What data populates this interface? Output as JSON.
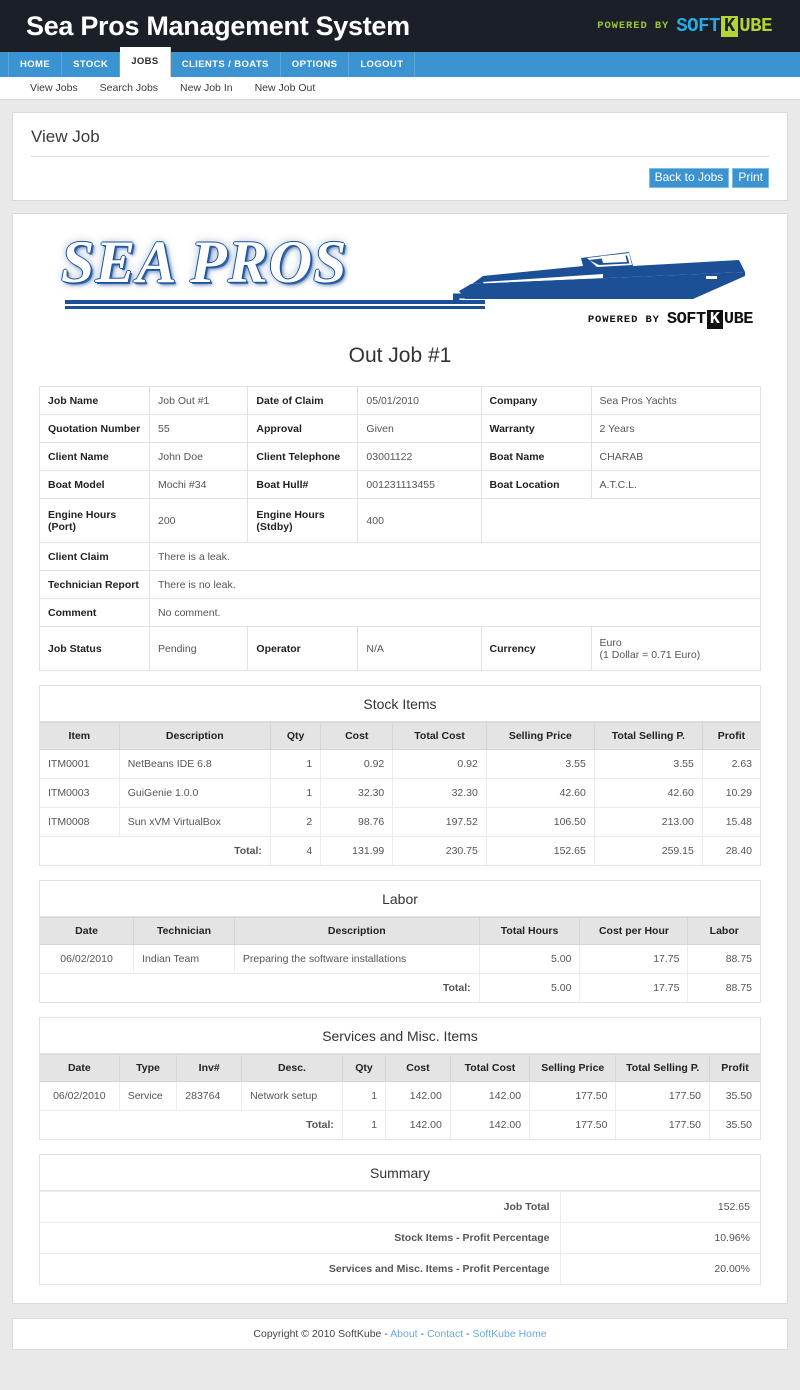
{
  "header": {
    "app_title": "Sea Pros Management System",
    "brand": {
      "powered_by": "POWERED BY",
      "soft": "SOFT",
      "k": "K",
      "ube": "UBE"
    },
    "brand_colors": {
      "powered_by": "#9ec43a",
      "soft": "#29abe2",
      "ube": "#b5d334",
      "k_bg": "#b5d334",
      "bar_bg": "#1b1f27"
    }
  },
  "nav": {
    "tabs": [
      {
        "label": "HOME",
        "active": false
      },
      {
        "label": "STOCK",
        "active": false
      },
      {
        "label": "JOBS",
        "active": true
      },
      {
        "label": "CLIENTS / BOATS",
        "active": false
      },
      {
        "label": "OPTIONS",
        "active": false
      },
      {
        "label": "LOGOUT",
        "active": false
      }
    ],
    "accent": "#3b93d1",
    "subnav": [
      "View Jobs",
      "Search Jobs",
      "New Job In",
      "New Job Out"
    ]
  },
  "page": {
    "title": "View Job",
    "buttons": [
      {
        "label": "Back to Jobs"
      },
      {
        "label": "Print"
      }
    ]
  },
  "document": {
    "logo_text": "SEA PROS",
    "brand": {
      "powered_by": "POWERED BY",
      "soft": "SOFT",
      "k": "K",
      "ube": "UBE"
    },
    "doc_title": "Out Job #1",
    "details_rows": [
      [
        {
          "label": "Job Name",
          "value": "Job Out #1"
        },
        {
          "label": "Date of Claim",
          "value": "05/01/2010"
        },
        {
          "label": "Company",
          "value": "Sea Pros Yachts"
        }
      ],
      [
        {
          "label": "Quotation Number",
          "value": "55"
        },
        {
          "label": "Approval",
          "value": "Given"
        },
        {
          "label": "Warranty",
          "value": "2 Years"
        }
      ],
      [
        {
          "label": "Client Name",
          "value": "John Doe"
        },
        {
          "label": "Client Telephone",
          "value": "03001122"
        },
        {
          "label": "Boat Name",
          "value": "CHARAB"
        }
      ],
      [
        {
          "label": "Boat Model",
          "value": "Mochi #34"
        },
        {
          "label": "Boat Hull#",
          "value": "001231113455"
        },
        {
          "label": "Boat Location",
          "value": "A.T.C.L."
        }
      ]
    ],
    "engine_row": {
      "port_label": "Engine Hours (Port)",
      "port_value": "200",
      "stdby_label": "Engine Hours (Stdby)",
      "stdby_value": "400"
    },
    "text_rows": [
      {
        "label": "Client Claim",
        "value": "There is a leak."
      },
      {
        "label": "Technician Report",
        "value": "There is no leak."
      },
      {
        "label": "Comment",
        "value": "No comment."
      }
    ],
    "status_row": {
      "status_label": "Job Status",
      "status_value": "Pending",
      "operator_label": "Operator",
      "operator_value": "N/A",
      "currency_label": "Currency",
      "currency_value_line1": "Euro",
      "currency_value_line2": "(1 Dollar = 0.71 Euro)"
    }
  },
  "stock_items": {
    "title": "Stock Items",
    "columns": [
      "Item",
      "Description",
      "Qty",
      "Cost",
      "Total Cost",
      "Selling Price",
      "Total Selling P.",
      "Profit"
    ],
    "rows": [
      [
        "ITM0001",
        "NetBeans IDE 6.8",
        "1",
        "0.92",
        "0.92",
        "3.55",
        "3.55",
        "2.63"
      ],
      [
        "ITM0003",
        "GuiGenie 1.0.0",
        "1",
        "32.30",
        "32.30",
        "42.60",
        "42.60",
        "10.29"
      ],
      [
        "ITM0008",
        "Sun xVM VirtualBox",
        "2",
        "98.76",
        "197.52",
        "106.50",
        "213.00",
        "15.48"
      ]
    ],
    "total_label": "Total:",
    "totals": [
      "4",
      "131.99",
      "230.75",
      "152.65",
      "259.15",
      "28.40"
    ]
  },
  "labor": {
    "title": "Labor",
    "columns": [
      "Date",
      "Technician",
      "Description",
      "Total Hours",
      "Cost per Hour",
      "Labor"
    ],
    "rows": [
      [
        "06/02/2010",
        "Indian Team",
        "Preparing the software installations",
        "5.00",
        "17.75",
        "88.75"
      ]
    ],
    "total_label": "Total:",
    "totals": [
      "5.00",
      "17.75",
      "88.75"
    ]
  },
  "services": {
    "title": "Services and Misc. Items",
    "columns": [
      "Date",
      "Type",
      "Inv#",
      "Desc.",
      "Qty",
      "Cost",
      "Total Cost",
      "Selling Price",
      "Total Selling P.",
      "Profit"
    ],
    "rows": [
      [
        "06/02/2010",
        "Service",
        "283764",
        "Network setup",
        "1",
        "142.00",
        "142.00",
        "177.50",
        "177.50",
        "35.50"
      ]
    ],
    "total_label": "Total:",
    "totals": [
      "1",
      "142.00",
      "142.00",
      "177.50",
      "177.50",
      "35.50"
    ]
  },
  "summary": {
    "title": "Summary",
    "rows": [
      {
        "label": "Job Total",
        "value": "152.65"
      },
      {
        "label": "Stock Items - Profit Percentage",
        "value": "10.96%"
      },
      {
        "label": "Services and Misc. Items - Profit Percentage",
        "value": "20.00%"
      }
    ]
  },
  "footer": {
    "copyright": "Copyright © 2010 SoftKube - ",
    "links": [
      "About",
      "Contact",
      "SoftKube Home"
    ],
    "sep": " - "
  }
}
